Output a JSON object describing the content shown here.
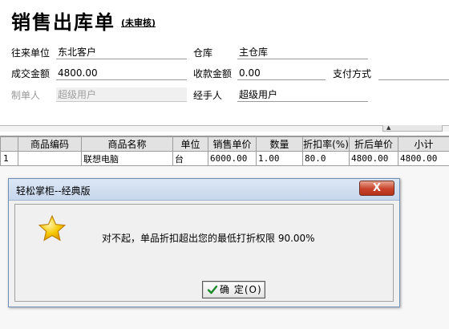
{
  "header": {
    "title": "销售出库单",
    "status": "(未审核)"
  },
  "form": {
    "customer_label": "往来单位",
    "customer_value": "东北客户",
    "warehouse_label": "仓库",
    "warehouse_value": "主仓库",
    "amount_label": "成交金额",
    "amount_value": "4800.00",
    "received_label": "收款金额",
    "received_value": "0.00",
    "payment_label": "支付方式",
    "payment_value": "",
    "maker_label": "制单人",
    "maker_value": "超级用户",
    "handler_label": "经手人",
    "handler_value": "超级用户"
  },
  "grid": {
    "columns": [
      "",
      "商品编码",
      "商品名称",
      "单位",
      "销售单价",
      "数量",
      "折扣率(%)",
      "折后单价",
      "小计"
    ],
    "rows": [
      [
        "1",
        "",
        "联想电脑",
        "台",
        "6000.00",
        "1.00",
        "80.0",
        "4800.00",
        "4800.00"
      ]
    ]
  },
  "dialog": {
    "title": "轻松掌柜--经典版",
    "close_label": "X",
    "message": "对不起，单品折扣超出您的最低打折权限 90.00%",
    "ok_label": "确 定(O)",
    "icon": "star-icon"
  },
  "colors": {
    "dialog_border": "#6f8fb7",
    "close_button": "#c8432a",
    "star": "#f5b800"
  }
}
